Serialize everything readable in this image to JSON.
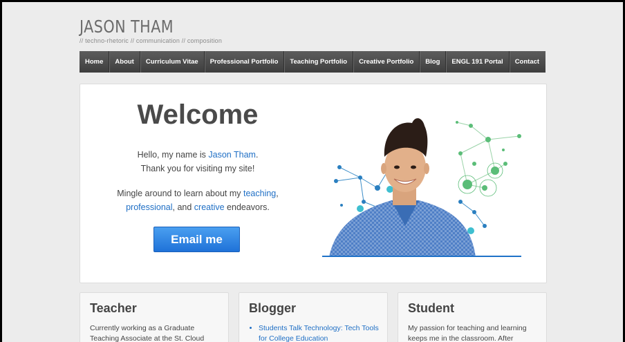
{
  "site": {
    "title": "JASON THAM",
    "tagline": "// techno-rhetoric // communication // composition"
  },
  "nav": {
    "items": [
      {
        "label": "Home"
      },
      {
        "label": "About"
      },
      {
        "label": "Curriculum Vitae"
      },
      {
        "label": "Professional Portfolio"
      },
      {
        "label": "Teaching Portfolio"
      },
      {
        "label": "Creative Portfolio"
      },
      {
        "label": "Blog"
      },
      {
        "label": "ENGL 191 Portal"
      },
      {
        "label": "Contact"
      }
    ]
  },
  "hero": {
    "heading": "Welcome",
    "intro_pre": "Hello, my name is ",
    "intro_name": "Jason Tham",
    "intro_post": ".",
    "intro_line2": "Thank you for visiting my site!",
    "mingle_pre": "Mingle around to learn about my ",
    "link_teaching": "teaching",
    "sep1": ",",
    "link_professional": "professional",
    "sep2": ", and ",
    "link_creative": "creative",
    "mingle_post": " endeavors.",
    "email_button": "Email me"
  },
  "cards": {
    "teacher": {
      "title": "Teacher",
      "text": "Currently working as a Graduate Teaching Associate at the St. Cloud State"
    },
    "blogger": {
      "title": "Blogger",
      "link": "Students Talk Technology: Tech Tools for College Education"
    },
    "student": {
      "title": "Student",
      "text": "My passion for teaching and learning keeps me in the classroom. After earning"
    }
  },
  "colors": {
    "accent_link": "#1f6fc5",
    "nav_bg": "#4a4a4a",
    "button": "#2b82e0"
  }
}
